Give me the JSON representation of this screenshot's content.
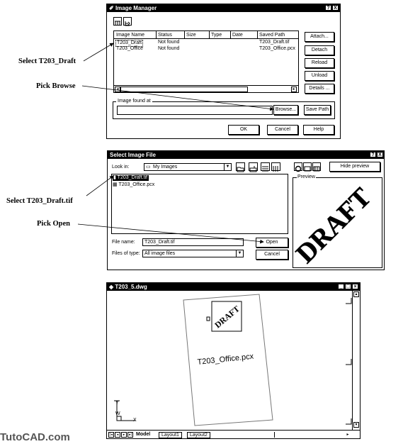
{
  "callouts": {
    "select_draft": "Select T203_Draft",
    "pick_browse": "Pick Browse",
    "select_tif": "Select T203_Draft.tif",
    "pick_open": "Pick Open"
  },
  "image_manager": {
    "title": "Image Manager",
    "help_btn": "?",
    "close_btn": "X",
    "columns": [
      "Image Name",
      "Status",
      "Size",
      "Type",
      "Date",
      "Saved Path"
    ],
    "rows": [
      {
        "name": "T203_Draft",
        "status": "Not found",
        "path": "T203_Draft.tif"
      },
      {
        "name": "T203_Office",
        "status": "Not found",
        "path": "T203_Office.pcx"
      }
    ],
    "buttons": [
      "Attach...",
      "Detach",
      "Reload",
      "Unload",
      "Details ..."
    ],
    "found_at_label": "Image found at",
    "browse": "Browse...",
    "save_path": "Save Path",
    "ok": "OK",
    "cancel": "Cancel",
    "help": "Help"
  },
  "select_file": {
    "title": "Select Image File",
    "help_btn": "?",
    "close_btn": "X",
    "look_in_label": "Look in:",
    "look_in_value": "My Images",
    "hide_preview": "Hide preview",
    "files": [
      "T203_Draft.tif",
      "T203_Office.pcx"
    ],
    "preview_label": "Preview",
    "preview_stamp": "DRAFT",
    "file_name_label": "File name:",
    "file_name_value": "T203_Draft.tif",
    "file_type_label": "Files of type:",
    "file_type_value": "All image files",
    "open": "Open",
    "cancel": "Cancel"
  },
  "drawing": {
    "title": "T203_5.dwg",
    "stamp": "DRAFT",
    "office_text": "T203_Office.pcx",
    "tabs": [
      "Model",
      "Layout1",
      "Layout2"
    ],
    "ucs_y": "Y",
    "ucs_w": "W",
    "ucs_x": "X"
  },
  "watermark": "TutoCAD.com"
}
